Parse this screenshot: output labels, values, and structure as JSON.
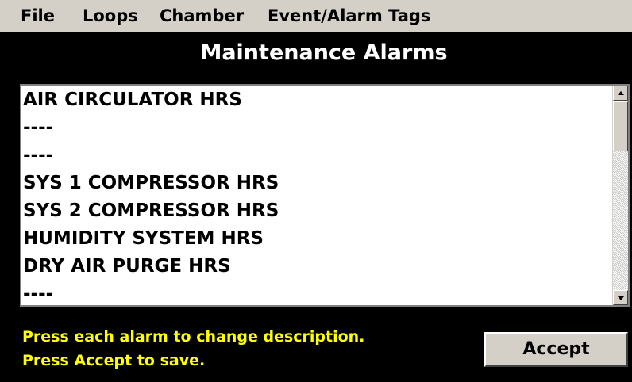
{
  "menu": {
    "items": [
      "File",
      "Loops",
      "Chamber",
      "Event/Alarm Tags"
    ]
  },
  "title": "Maintenance Alarms",
  "alarms": {
    "items": [
      "AIR CIRCULATOR HRS",
      "----",
      "----",
      "SYS 1 COMPRESSOR HRS",
      "SYS 2 COMPRESSOR HRS",
      "HUMIDITY SYSTEM HRS",
      "DRY AIR PURGE HRS",
      "----"
    ]
  },
  "instructions": {
    "line1": "Press each alarm to change description.",
    "line2": "Press Accept to save."
  },
  "buttons": {
    "accept": "Accept"
  },
  "colors": {
    "background": "#000000",
    "menubar": "#d4d0c8",
    "title_text": "#ffffff",
    "instruction_text": "#ffff00",
    "list_background": "#ffffff"
  },
  "icons": {
    "scroll_up": "triangle-up",
    "scroll_down": "triangle-down"
  }
}
